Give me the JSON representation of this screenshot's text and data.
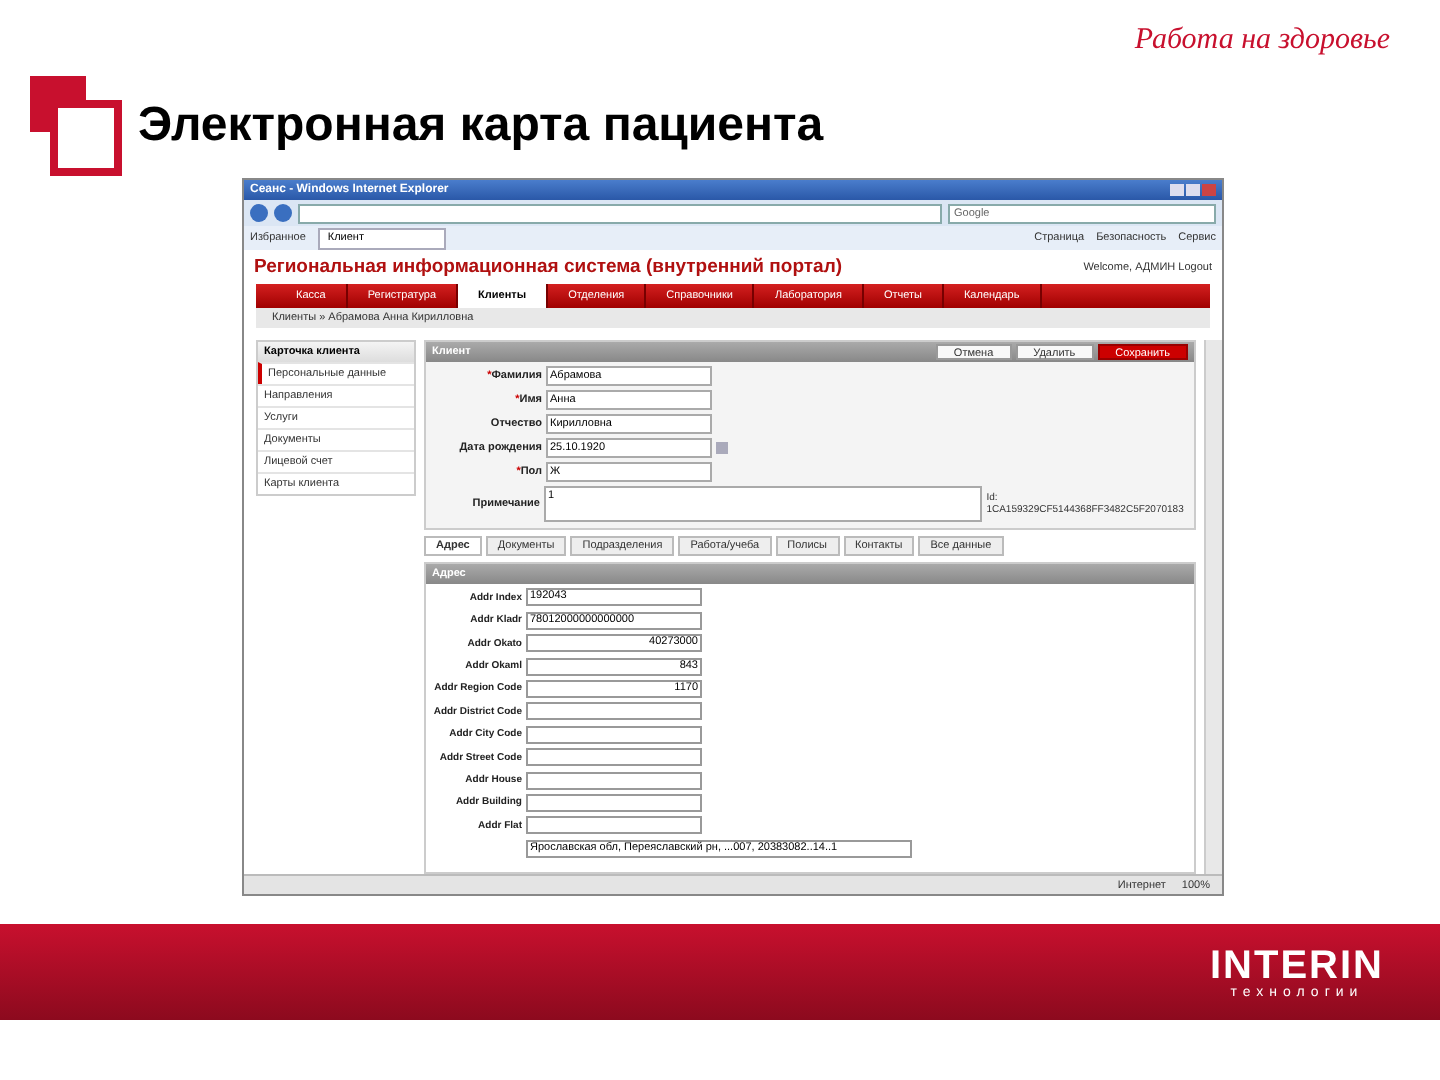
{
  "slide": {
    "logo_text": "Работа на здоровье",
    "title": "Электронная карта пациента",
    "brand": {
      "name": "INTERIN",
      "tagline": "технологии"
    }
  },
  "browser": {
    "title": "Сеанс - Windows Internet Explorer",
    "search_placeholder": "Google",
    "favorites": "Избранное",
    "tab": "Клиент",
    "menus": [
      "Страница",
      "Безопасность",
      "Сервис"
    ],
    "status_zone": "Интернет",
    "zoom": "100%"
  },
  "app": {
    "title": "Региональная информационная система (внутренний портал)",
    "user": "Welcome, АДМИН Logout",
    "nav": [
      {
        "label": "Касса",
        "selected": false
      },
      {
        "label": "Регистратура",
        "selected": false
      },
      {
        "label": "Клиенты",
        "selected": true
      },
      {
        "label": "Отделения",
        "selected": false
      },
      {
        "label": "Справочники",
        "selected": false
      },
      {
        "label": "Лаборатория",
        "selected": false
      },
      {
        "label": "Отчеты",
        "selected": false
      },
      {
        "label": "Календарь",
        "selected": false
      }
    ],
    "breadcrumb": "Клиенты » Абрамова Анна Кирилловна",
    "sidebar": {
      "title": "Карточка клиента",
      "items": [
        {
          "label": "Персональные данные",
          "selected": true
        },
        {
          "label": "Направления",
          "selected": false
        },
        {
          "label": "Услуги",
          "selected": false
        },
        {
          "label": "Документы",
          "selected": false
        },
        {
          "label": "Лицевой счет",
          "selected": false
        },
        {
          "label": "Карты клиента",
          "selected": false
        }
      ]
    },
    "client": {
      "title": "Клиент",
      "buttons": [
        {
          "label": "Отмена",
          "kind": "plain"
        },
        {
          "label": "Удалить",
          "kind": "plain"
        },
        {
          "label": "Сохранить",
          "kind": "primary"
        }
      ],
      "fields": [
        {
          "label": "Фамилия",
          "required_mark": "*",
          "value": "Абрамова",
          "kind": "text"
        },
        {
          "label": "Имя",
          "required_mark": "*",
          "value": "Анна",
          "kind": "text"
        },
        {
          "label": "Отчество",
          "value": "Кирилловна",
          "kind": "text"
        },
        {
          "label": "Дата рождения",
          "value": "25.10.1920",
          "kind": "date"
        },
        {
          "label": "Пол",
          "required_mark": "*",
          "value": "Ж",
          "kind": "text"
        },
        {
          "label": "Примечание",
          "value": "1",
          "kind": "memo"
        }
      ],
      "id_text": "Id: 1CA159329CF5144368FF3482C5F2070183"
    },
    "tabs": [
      {
        "label": "Адрес",
        "selected": true
      },
      {
        "label": "Документы",
        "selected": false
      },
      {
        "label": "Подразделения",
        "selected": false
      },
      {
        "label": "Работа/учеба",
        "selected": false
      },
      {
        "label": "Полисы",
        "selected": false
      },
      {
        "label": "Контакты",
        "selected": false
      },
      {
        "label": "Все данные",
        "selected": false
      }
    ],
    "address": {
      "title": "Адрес",
      "fields": [
        {
          "label": "Addr Index",
          "value": "192043",
          "kind": "text"
        },
        {
          "label": "Addr Kladr",
          "value": "78012000000000000",
          "kind": "text"
        },
        {
          "label": "Addr Okato",
          "value": "40273000",
          "kind": "number"
        },
        {
          "label": "Addr Okaml",
          "value": "843",
          "kind": "number"
        },
        {
          "label": "Addr Region Code",
          "value": "1170",
          "kind": "number"
        },
        {
          "label": "Addr District Code",
          "kind": "text"
        },
        {
          "label": "Addr City Code",
          "kind": "text"
        },
        {
          "label": "Addr Street Code",
          "kind": "text"
        },
        {
          "label": "Addr House",
          "kind": "text"
        },
        {
          "label": "Addr Building",
          "kind": "text"
        },
        {
          "label": "Addr Flat",
          "kind": "text"
        }
      ],
      "full_value": "Ярославская обл, Переяславский рн, ...007, 20383082..14..1"
    }
  }
}
